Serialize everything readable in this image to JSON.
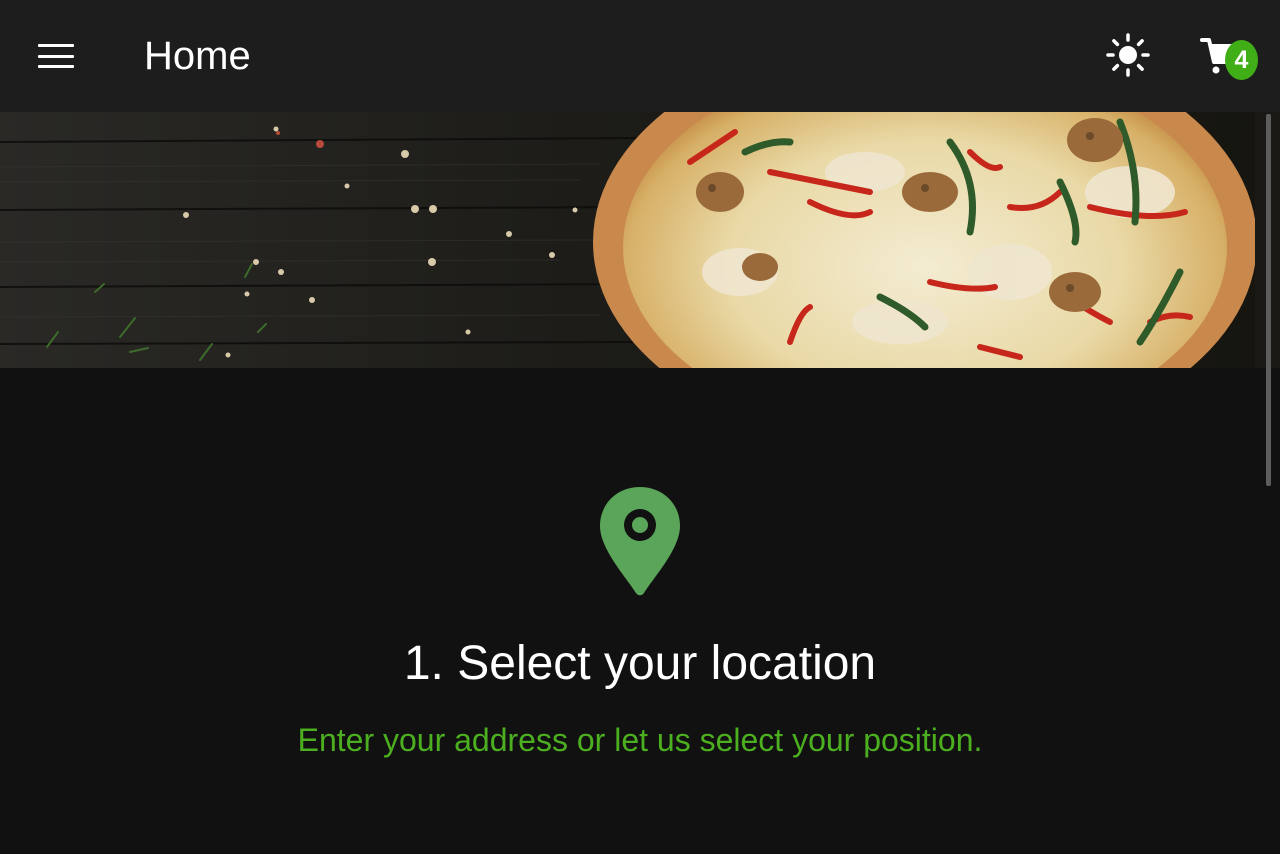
{
  "header": {
    "title": "Home",
    "menu_icon": "hamburger-menu-icon",
    "theme_icon": "sun-icon",
    "cart_icon": "shopping-cart-icon",
    "cart_count": "4"
  },
  "hero": {
    "image": "pizza-on-wooden-table"
  },
  "location_step": {
    "icon": "map-pin-icon",
    "title": "1. Select your location",
    "subtitle": "Enter your address or let us select your position."
  },
  "colors": {
    "background": "#111111",
    "topbar": "#1d1d1d",
    "accent_green": "#4caf1f",
    "badge_green": "#3fae17",
    "pin_green": "#5aa55a",
    "text": "#ffffff"
  }
}
